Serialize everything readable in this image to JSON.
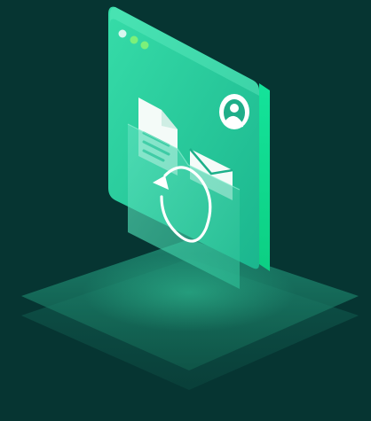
{
  "illustration": {
    "subject": "isometric-app-window-with-file-sync",
    "icons": [
      "window-dots-icon",
      "document-icon",
      "envelope-icon",
      "refresh-icon",
      "user-avatar-icon",
      "folder-icon"
    ],
    "colors": {
      "background": "#063532",
      "platform_top": "#1a7a66",
      "platform_bottom": "#12594c",
      "window_face": "#2ad3a3",
      "window_edge": "#11e08f",
      "window_dot_white": "#d9f7ef",
      "window_dot_green": "#7cf07a",
      "folder_glass": "#4fd6b2",
      "document_white": "#f4fbf8",
      "avatar_ring": "#ffffff",
      "avatar_fill": "#1fae89"
    }
  }
}
